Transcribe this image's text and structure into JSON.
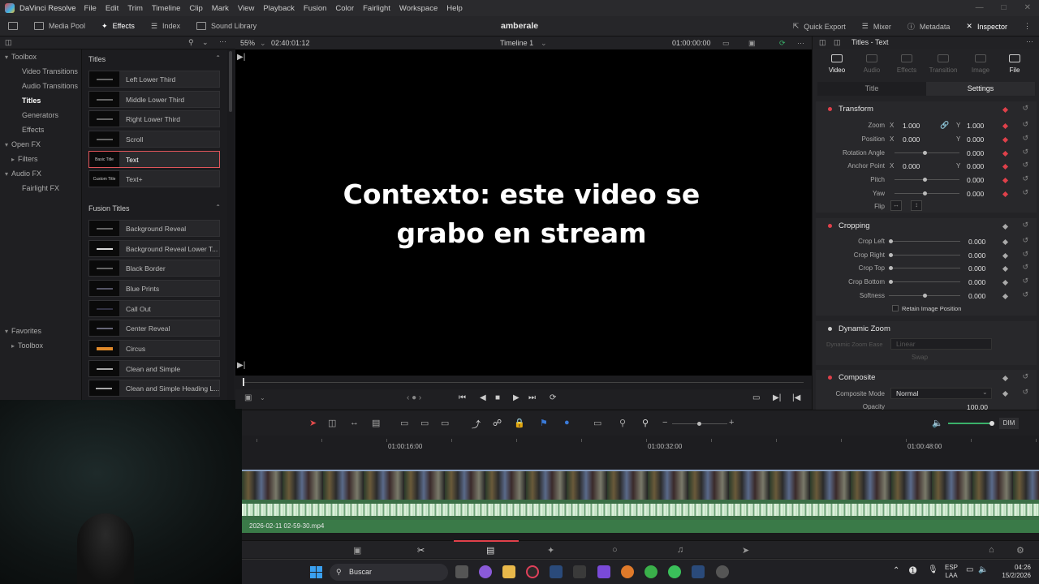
{
  "app": {
    "name": "DaVinci Resolve",
    "project": "amberale"
  },
  "menu": [
    "File",
    "Edit",
    "Trim",
    "Timeline",
    "Clip",
    "Mark",
    "View",
    "Playback",
    "Fusion",
    "Color",
    "Fairlight",
    "Workspace",
    "Help"
  ],
  "toolbar": {
    "media_pool": "Media Pool",
    "effects": "Effects",
    "index": "Index",
    "sound_library": "Sound Library",
    "quick_export": "Quick Export",
    "mixer": "Mixer",
    "metadata": "Metadata",
    "inspector": "Inspector"
  },
  "tree": {
    "toolbox": "Toolbox",
    "video_transitions": "Video Transitions",
    "audio_transitions": "Audio Transitions",
    "titles": "Titles",
    "generators": "Generators",
    "effects": "Effects",
    "open_fx": "Open FX",
    "filters": "Filters",
    "audio_fx": "Audio FX",
    "fairlight_fx": "Fairlight FX",
    "favorites": "Favorites",
    "fav_toolbox": "Toolbox"
  },
  "list": {
    "titles_header": "Titles",
    "titles": [
      {
        "thumb": "",
        "label": "Left Lower Third"
      },
      {
        "thumb": "",
        "label": "Middle Lower Third"
      },
      {
        "thumb": "",
        "label": "Right Lower Third"
      },
      {
        "thumb": "",
        "label": "Scroll"
      },
      {
        "thumb": "Basic Title",
        "label": "Text"
      },
      {
        "thumb": "Custom Title",
        "label": "Text+"
      }
    ],
    "fusion_header": "Fusion Titles",
    "fusion": [
      {
        "thumb": "",
        "label": "Background Reveal"
      },
      {
        "thumb": "",
        "label": "Background Reveal Lower T..."
      },
      {
        "thumb": "",
        "label": "Black Border"
      },
      {
        "thumb": "",
        "label": "Blue Prints"
      },
      {
        "thumb": "",
        "label": "Call Out"
      },
      {
        "thumb": "",
        "label": "Center Reveal"
      },
      {
        "thumb": "",
        "label": "Circus"
      },
      {
        "thumb": "",
        "label": "Clean and Simple"
      },
      {
        "thumb": "",
        "label": "Clean and Simple Heading L..."
      }
    ]
  },
  "viewer": {
    "zoom": "55%",
    "source_tc": "02:40:01:12",
    "timeline_name": "Timeline 1",
    "current_tc": "01:00:00:00",
    "overlay_line1": "Contexto: este video se",
    "overlay_line2": "grabo en stream"
  },
  "inspector": {
    "title": "Titles - Text",
    "tabs": [
      "Video",
      "Audio",
      "Effects",
      "Transition",
      "Image",
      "File"
    ],
    "subtabs": [
      "Title",
      "Settings"
    ],
    "transform": {
      "header": "Transform",
      "zoom": "Zoom",
      "zoom_x": "1.000",
      "zoom_y": "1.000",
      "position": "Position",
      "pos_x": "0.000",
      "pos_y": "0.000",
      "rotation": "Rotation Angle",
      "rotation_val": "0.000",
      "anchor": "Anchor Point",
      "anchor_x": "0.000",
      "anchor_y": "0.000",
      "pitch": "Pitch",
      "pitch_val": "0.000",
      "yaw": "Yaw",
      "yaw_val": "0.000",
      "flip": "Flip",
      "x": "X",
      "y": "Y"
    },
    "cropping": {
      "header": "Cropping",
      "left": "Crop Left",
      "left_val": "0.000",
      "right": "Crop Right",
      "right_val": "0.000",
      "top": "Crop Top",
      "top_val": "0.000",
      "bottom": "Crop Bottom",
      "bottom_val": "0.000",
      "softness": "Softness",
      "softness_val": "0.000",
      "retain": "Retain Image Position"
    },
    "dynamic_zoom": {
      "header": "Dynamic Zoom",
      "ease": "Dynamic Zoom Ease",
      "ease_val": "Linear",
      "swap": "Swap"
    },
    "composite": {
      "header": "Composite",
      "mode": "Composite Mode",
      "mode_val": "Normal",
      "opacity": "Opacity",
      "opacity_val": "100.00"
    }
  },
  "timeline": {
    "timecodes": [
      "01:00:16:00",
      "01:00:32:00",
      "01:00:48:00"
    ],
    "clip_name": "2026-02-11 02-59-30.mp4",
    "dim": "DIM"
  },
  "taskbar": {
    "search": "Buscar",
    "lang1": "ESP",
    "lang2": "LAA",
    "time": "04:26",
    "date": "15/2/2026"
  },
  "colors": {
    "accent": "#e0404a",
    "audio_track": "#3a6e45"
  }
}
